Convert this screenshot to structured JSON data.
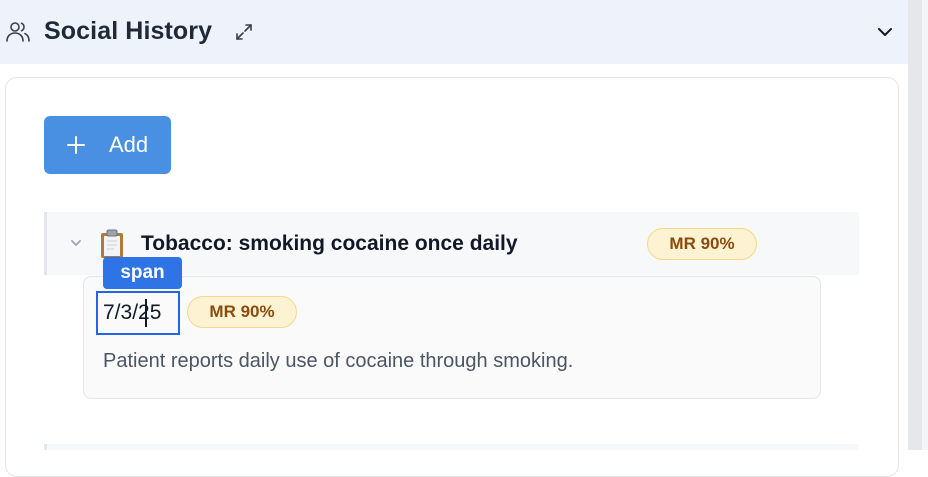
{
  "header": {
    "title": "Social History",
    "icon": "people-icon",
    "expand_icon": "expand-arrows-icon",
    "collapse_icon": "chevron-down-icon"
  },
  "toolbar": {
    "add_label": "Add",
    "add_icon": "plus-icon",
    "add_color": "#4a90e2"
  },
  "entries": [
    {
      "icon": "clipboard-icon",
      "title": "Tobacco: smoking cocaine once daily",
      "badge": "MR 90%",
      "expanded": true,
      "detail": {
        "date": "7/3/25",
        "badge": "MR 90%",
        "note": "Patient reports daily use of cocaine through smoking."
      }
    }
  ],
  "inspector": {
    "tooltip": "span",
    "highlight_color": "#2563eb"
  },
  "colors": {
    "header_bg": "#eef2fb",
    "badge_bg": "#fdf3d2",
    "badge_text": "#8a4b11"
  }
}
